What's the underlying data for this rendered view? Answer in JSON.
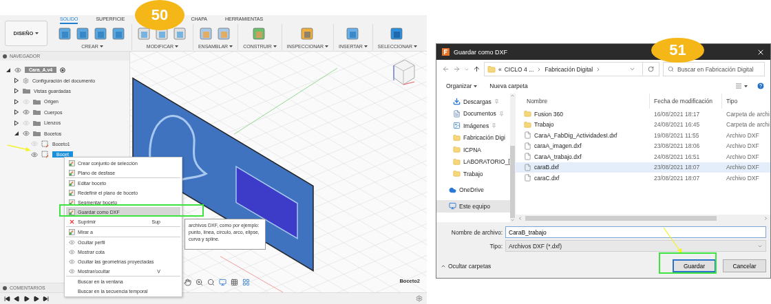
{
  "fusion": {
    "step_badge": "50",
    "workspace": "DISEÑO",
    "tabs": [
      {
        "label": "SOLIDO",
        "selected": true
      },
      {
        "label": "SUPERFICIE",
        "selected": false
      },
      {
        "label": "CHAPA",
        "selected": false
      },
      {
        "label": "HERRAMIENTAS",
        "selected": false
      }
    ],
    "tool_groups": [
      "CREAR",
      "MODIFICAR",
      "ENSAMBLAR",
      "CONSTRUIR",
      "INSPECCIONAR",
      "INSERTAR",
      "SELECCIONAR"
    ],
    "navigator": {
      "title": "NAVEGADOR",
      "tree": [
        {
          "label": "Cara_A.v4",
          "kind": "document",
          "expanded": true,
          "visible": true,
          "selected": false,
          "children": [
            {
              "label": "Configuración del documento",
              "kind": "settings",
              "expanded": false,
              "selected": false
            },
            {
              "label": "Vistas guardadas",
              "kind": "folder",
              "expanded": false,
              "selected": false
            },
            {
              "label": "Origen",
              "kind": "folder",
              "expanded": false,
              "visible": false,
              "selected": false
            },
            {
              "label": "Cuerpos",
              "kind": "folder",
              "expanded": false,
              "visible": true,
              "selected": false
            },
            {
              "label": "Lienzos",
              "kind": "folder",
              "expanded": false,
              "visible": false,
              "selected": false
            },
            {
              "label": "Bocetos",
              "kind": "folder",
              "expanded": true,
              "visible": true,
              "selected": false,
              "children": [
                {
                  "label": "Boceto1",
                  "kind": "sketch",
                  "visible": false,
                  "selected": false
                },
                {
                  "label": "Bocet",
                  "kind": "sketch",
                  "visible": true,
                  "selected": true
                }
              ]
            }
          ]
        }
      ]
    },
    "comments": "COMENTARIOS",
    "viewport_label": "Boceto2",
    "context_menu": {
      "groups": [
        [
          {
            "label": "Crear conjunto de selección",
            "kind": "action",
            "highlighted": false
          },
          {
            "label": "Plano de desfase",
            "kind": "action",
            "highlighted": false
          }
        ],
        [
          {
            "label": "Editar boceto",
            "kind": "action",
            "highlighted": false
          },
          {
            "label": "Redefinir el plano de boceto",
            "kind": "action",
            "highlighted": false
          },
          {
            "label": "Segmentar boceto",
            "kind": "action",
            "highlighted": false
          },
          {
            "label": "Guardar como DXF",
            "kind": "action",
            "highlighted": true
          },
          {
            "label": "Suprimir",
            "shortcut": "Sup",
            "kind": "delete",
            "highlighted": false
          }
        ],
        [
          {
            "label": "Mirar a",
            "kind": "action",
            "highlighted": false
          }
        ],
        [
          {
            "label": "Ocultar perfil",
            "kind": "visibility",
            "highlighted": false
          },
          {
            "label": "Mostrar cota",
            "kind": "visibility",
            "highlighted": false
          },
          {
            "label": "Ocultar las geometrías proyectadas",
            "kind": "visibility",
            "highlighted": false
          },
          {
            "label": "Mostrar/ocultar",
            "shortcut": "V",
            "kind": "visibility",
            "highlighted": false
          }
        ],
        [
          {
            "label": "Buscar en la ventana",
            "kind": "search",
            "highlighted": false
          },
          {
            "label": "Buscar en la secuencia temporal",
            "kind": "search",
            "highlighted": false
          }
        ]
      ]
    },
    "tooltip": "archivos DXF, como por ejemplo: punto, línea, círculo, arco, elipse, curva y spline."
  },
  "dialog": {
    "title": "Guardar como DXF",
    "step_badge": "51",
    "address": {
      "overflow": "«",
      "crumbs": [
        "CICLO 4 ...",
        "Fabricación Digital"
      ]
    },
    "search": {
      "placeholder": "Buscar en Fabricación Digital"
    },
    "toolbar": {
      "organize": "Organizar",
      "new_folder": "Nueva carpeta"
    },
    "nav": [
      {
        "label": "Descargas",
        "kind": "downloads",
        "pinned": true,
        "selected": false
      },
      {
        "label": "Documentos",
        "kind": "documents",
        "pinned": true,
        "selected": false
      },
      {
        "label": "Imágenes",
        "kind": "pictures",
        "pinned": true,
        "selected": false
      },
      {
        "label": "Fabricación Digi",
        "kind": "folder",
        "pinned": false,
        "selected": false
      },
      {
        "label": "ICPNA",
        "kind": "folder",
        "pinned": false,
        "selected": false
      },
      {
        "label": "LABORATORIO_[",
        "kind": "folder",
        "pinned": false,
        "selected": false
      },
      {
        "label": "Trabajo",
        "kind": "folder",
        "pinned": false,
        "selected": false
      },
      {
        "label": "OneDrive",
        "kind": "cloud",
        "pinned": false,
        "selected": false
      },
      {
        "label": "Este equipo",
        "kind": "computer",
        "pinned": false,
        "selected": true
      }
    ],
    "columns": [
      "Nombre",
      "Fecha de modificación",
      "Tipo"
    ],
    "files": [
      {
        "name": "Fusion 360",
        "date": "16/08/2021 18:17",
        "type": "Carpeta de archi",
        "kind": "folder",
        "selected": false
      },
      {
        "name": "Trabajo",
        "date": "24/08/2021 16:45",
        "type": "Carpeta de archi",
        "kind": "folder",
        "selected": false
      },
      {
        "name": "CaraA_FabDig_ActividadesI.dxf",
        "date": "19/08/2021 11:55",
        "type": "Archivo DXF",
        "kind": "file",
        "selected": false
      },
      {
        "name": "caraA_imagen.dxf",
        "date": "23/08/2021 18:06",
        "type": "Archivo DXF",
        "kind": "file",
        "selected": false
      },
      {
        "name": "CaraA_trabajo.dxf",
        "date": "24/08/2021 16:51",
        "type": "Archivo DXF",
        "kind": "file",
        "selected": false
      },
      {
        "name": "caraB.dxf",
        "date": "23/08/2021 18:07",
        "type": "Archivo DXF",
        "kind": "file",
        "selected": true
      },
      {
        "name": "caraC.dxf",
        "date": "23/08/2021 18:07",
        "type": "Archivo DXF",
        "kind": "file",
        "selected": false
      }
    ],
    "filename_label": "Nombre de archivo:",
    "filename": "CaraB_trabajo",
    "type_label": "Tipo:",
    "type_value": "Archivos DXF (*.dxf)",
    "hide_folders": "Ocultar carpetas",
    "buttons": [
      {
        "label": "Guardar",
        "kind": "primary"
      },
      {
        "label": "Cancelar",
        "kind": "secondary"
      }
    ]
  }
}
